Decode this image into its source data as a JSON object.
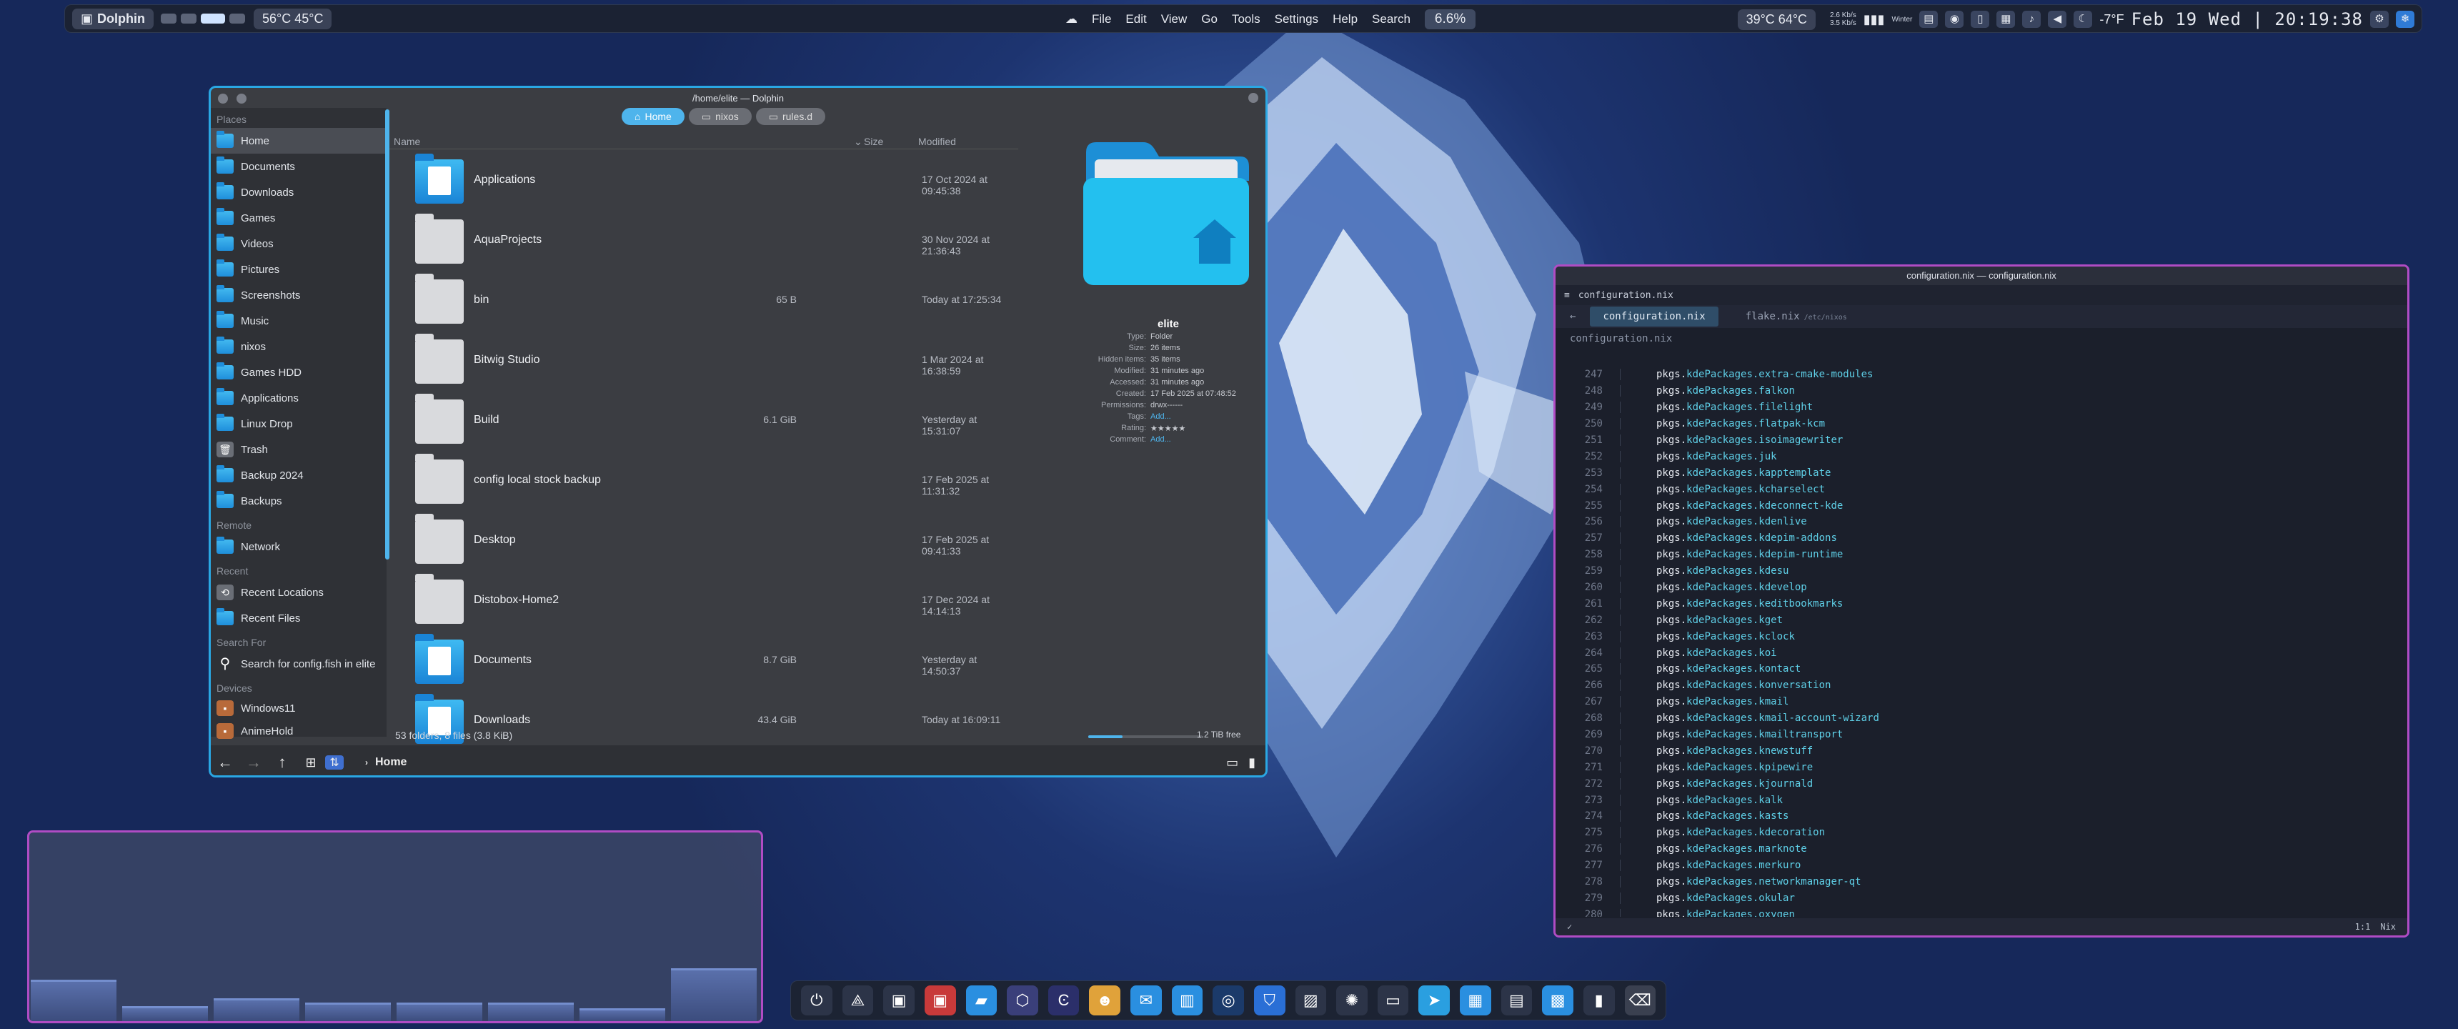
{
  "topbar": {
    "app_name": "Dolphin",
    "temps": "56°C  45°C",
    "menu": [
      "File",
      "Edit",
      "View",
      "Go",
      "Tools",
      "Settings",
      "Help",
      "Search"
    ],
    "cpu_pct": "6.6%",
    "right_temps": "39°C  64°C",
    "net_up": "2.6 Kb/s",
    "net_down": "3.5 Kb/s",
    "kbd": "Winter",
    "weather": "-7°F",
    "clock": "Feb 19 Wed | 20:19:38"
  },
  "dolphin": {
    "title": "/home/elite — Dolphin",
    "tabs": [
      "Home",
      "nixos",
      "rules.d"
    ],
    "places_header": "Places",
    "places": [
      "Home",
      "Documents",
      "Downloads",
      "Games",
      "Videos",
      "Pictures",
      "Screenshots",
      "Music",
      "nixos",
      "Games HDD",
      "Applications",
      "Linux Drop",
      "Trash",
      "Backup 2024",
      "Backups"
    ],
    "remote_header": "Remote",
    "remote": [
      "Network"
    ],
    "recent_header": "Recent",
    "recent": [
      "Recent Locations",
      "Recent Files"
    ],
    "search_header": "Search For",
    "search": [
      "Search for config.fish in elite"
    ],
    "devices_header": "Devices",
    "devices": [
      "Windows11",
      "AnimeHold"
    ],
    "columns": {
      "name": "Name",
      "size": "Size",
      "modified": "Modified"
    },
    "files": [
      {
        "name": "Applications",
        "size": "",
        "modified": "17 Oct 2024 at 09:45:38",
        "kind": "blue"
      },
      {
        "name": "AquaProjects",
        "size": "",
        "modified": "30 Nov 2024 at 21:36:43",
        "kind": "grey"
      },
      {
        "name": "bin",
        "size": "65 B",
        "modified": "Today at 17:25:34",
        "kind": "grey"
      },
      {
        "name": "Bitwig Studio",
        "size": "",
        "modified": "1 Mar 2024 at 16:38:59",
        "kind": "grey"
      },
      {
        "name": "Build",
        "size": "6.1 GiB",
        "modified": "Yesterday at 15:31:07",
        "kind": "grey"
      },
      {
        "name": "config local stock backup",
        "size": "",
        "modified": "17 Feb 2025 at 11:31:32",
        "kind": "grey"
      },
      {
        "name": "Desktop",
        "size": "",
        "modified": "17 Feb 2025 at 09:41:33",
        "kind": "grey"
      },
      {
        "name": "Distobox-Home2",
        "size": "",
        "modified": "17 Dec 2024 at 14:14:13",
        "kind": "grey"
      },
      {
        "name": "Documents",
        "size": "8.7 GiB",
        "modified": "Yesterday at 14:50:37",
        "kind": "blue"
      },
      {
        "name": "Downloads",
        "size": "43.4 GiB",
        "modified": "Today at 16:09:11",
        "kind": "blue"
      }
    ],
    "info": {
      "name": "elite",
      "rows": [
        {
          "k": "Type:",
          "v": "Folder"
        },
        {
          "k": "Size:",
          "v": "26 items"
        },
        {
          "k": "Hidden items:",
          "v": "35 items"
        },
        {
          "k": "Modified:",
          "v": "31 minutes ago"
        },
        {
          "k": "Accessed:",
          "v": "31 minutes ago"
        },
        {
          "k": "Created:",
          "v": "17 Feb 2025 at 07:48:52"
        },
        {
          "k": "Permissions:",
          "v": "drwx------"
        },
        {
          "k": "Tags:",
          "v": "Add..."
        },
        {
          "k": "Rating:",
          "v": "★★★★★"
        },
        {
          "k": "Comment:",
          "v": "Add..."
        }
      ]
    },
    "status": "53 folders, 8 files (3.8 KiB)",
    "free": "1.2 TiB free",
    "disk_used_fraction": 0.3,
    "breadcrumb": "Home"
  },
  "editor": {
    "title": "configuration.nix — configuration.nix",
    "bar_file": "configuration.nix",
    "tabs": [
      {
        "label": "configuration.nix",
        "path": ""
      },
      {
        "label": "flake.nix",
        "path": "/etc/nixos"
      }
    ],
    "path": "configuration.nix",
    "prefix": "pkgs.",
    "lines": [
      {
        "n": "247",
        "pkg": "kdePackages.extra-cmake-modules"
      },
      {
        "n": "248",
        "pkg": "kdePackages.falkon"
      },
      {
        "n": "249",
        "pkg": "kdePackages.filelight"
      },
      {
        "n": "250",
        "pkg": "kdePackages.flatpak-kcm"
      },
      {
        "n": "251",
        "pkg": "kdePackages.isoimagewriter"
      },
      {
        "n": "252",
        "pkg": "kdePackages.juk"
      },
      {
        "n": "253",
        "pkg": "kdePackages.kapptemplate"
      },
      {
        "n": "254",
        "pkg": "kdePackages.kcharselect"
      },
      {
        "n": "255",
        "pkg": "kdePackages.kdeconnect-kde"
      },
      {
        "n": "256",
        "pkg": "kdePackages.kdenlive"
      },
      {
        "n": "257",
        "pkg": "kdePackages.kdepim-addons"
      },
      {
        "n": "258",
        "pkg": "kdePackages.kdepim-runtime"
      },
      {
        "n": "259",
        "pkg": "kdePackages.kdesu"
      },
      {
        "n": "260",
        "pkg": "kdePackages.kdevelop"
      },
      {
        "n": "261",
        "pkg": "kdePackages.keditbookmarks"
      },
      {
        "n": "262",
        "pkg": "kdePackages.kget"
      },
      {
        "n": "263",
        "pkg": "kdePackages.kclock"
      },
      {
        "n": "264",
        "pkg": "kdePackages.koi"
      },
      {
        "n": "265",
        "pkg": "kdePackages.kontact"
      },
      {
        "n": "266",
        "pkg": "kdePackages.konversation"
      },
      {
        "n": "267",
        "pkg": "kdePackages.kmail"
      },
      {
        "n": "268",
        "pkg": "kdePackages.kmail-account-wizard"
      },
      {
        "n": "269",
        "pkg": "kdePackages.kmailtransport"
      },
      {
        "n": "270",
        "pkg": "kdePackages.knewstuff"
      },
      {
        "n": "271",
        "pkg": "kdePackages.kpipewire"
      },
      {
        "n": "272",
        "pkg": "kdePackages.kjournald"
      },
      {
        "n": "273",
        "pkg": "kdePackages.kalk"
      },
      {
        "n": "274",
        "pkg": "kdePackages.kasts"
      },
      {
        "n": "275",
        "pkg": "kdePackages.kdecoration"
      },
      {
        "n": "276",
        "pkg": "kdePackages.marknote"
      },
      {
        "n": "277",
        "pkg": "kdePackages.merkuro"
      },
      {
        "n": "278",
        "pkg": "kdePackages.networkmanager-qt"
      },
      {
        "n": "279",
        "pkg": "kdePackages.okular"
      },
      {
        "n": "280",
        "pkg": "kdePackages.oxygen"
      }
    ],
    "status_pos": "1:1",
    "status_lang": "Nix"
  },
  "visualizer": {
    "levels": [
      0.22,
      0.08,
      0.12,
      0.1,
      0.1,
      0.1,
      0.07,
      0.28
    ]
  },
  "dock": {
    "icons": [
      "power-icon",
      "network-icon",
      "terminal-icon",
      "terminal-red-icon",
      "files-icon",
      "browser-icon",
      "editor-icon",
      "avatar-icon",
      "mail-icon",
      "chart-icon",
      "steam-icon",
      "shield-icon",
      "notes-icon",
      "flow-icon",
      "monitor-icon",
      "telegram-icon",
      "calendar-icon",
      "chat-icon",
      "store-icon",
      "console-icon",
      "trash-icon"
    ]
  }
}
